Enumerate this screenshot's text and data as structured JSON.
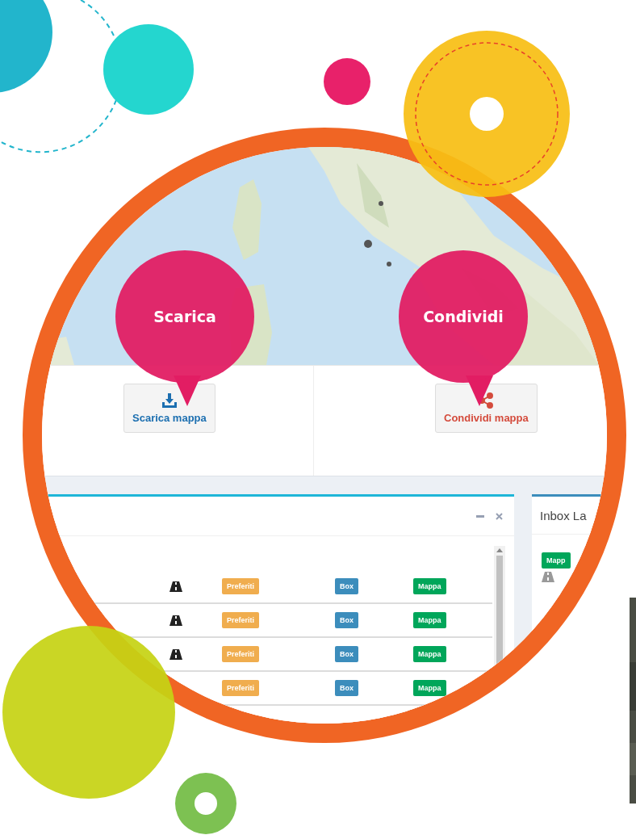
{
  "bubbles": [
    {
      "label": "Scarica"
    },
    {
      "label": "Condividi"
    }
  ],
  "actions": [
    {
      "label": "Scarica mappa",
      "kind": "download"
    },
    {
      "label": "Condividi mappa",
      "kind": "share"
    }
  ],
  "main_panel": {
    "rows": [
      {
        "road_icon": true,
        "favorite": "Preferiti",
        "box": "Box",
        "map": "Mappa"
      },
      {
        "road_icon": true,
        "favorite": "Preferiti",
        "box": "Box",
        "map": "Mappa"
      },
      {
        "road_icon": true,
        "favorite": "Preferiti",
        "box": "Box",
        "map": "Mappa"
      },
      {
        "road_icon": false,
        "favorite": "Preferiti",
        "box": "Box",
        "map": "Mappa"
      }
    ]
  },
  "side_panel": {
    "title": "Inbox La",
    "badge": "Mapp"
  }
}
